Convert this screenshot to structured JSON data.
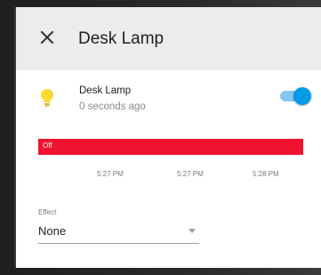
{
  "dialog": {
    "title": "Desk Lamp"
  },
  "entity": {
    "name": "Desk Lamp",
    "last_changed": "0 seconds ago",
    "state_on": true,
    "icon": "lightbulb-icon",
    "icon_color": "#fdd835"
  },
  "history": {
    "state_label": "Off",
    "bar_color": "#f0132f",
    "axis_labels": [
      "5:27 PM",
      "5:27 PM",
      "5:28 PM"
    ]
  },
  "effect": {
    "label": "Effect",
    "value": "None"
  },
  "colors": {
    "accent": "#039be5",
    "header_bg": "#ececec"
  }
}
